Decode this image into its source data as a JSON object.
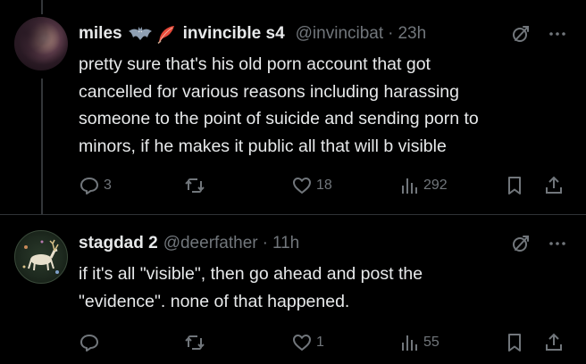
{
  "tweets": [
    {
      "name": "miles",
      "second_name": "invincible s4",
      "handle": "@invincibat",
      "separator": "·",
      "time": "23h",
      "text_lines": [
        "pretty sure that's his old porn account that got",
        "cancelled for various reasons including harassing",
        "someone to the point of suicide and sending porn to",
        "minors, if he makes it public all that will b visible"
      ],
      "reply_count": "3",
      "repost_count": "",
      "like_count": "18",
      "view_count": "292",
      "name_emojis": [
        "bat-emoji-icon",
        "feather-emoji-icon"
      ]
    },
    {
      "name": "stagdad 2",
      "handle": "@deerfather",
      "separator": "·",
      "time": "11h",
      "text_lines": [
        "if it's all \"visible\", then go ahead and post the",
        "\"evidence\". none of that happened."
      ],
      "reply_count": "",
      "repost_count": "",
      "like_count": "1",
      "view_count": "55"
    }
  ],
  "colors": {
    "background": "#000000",
    "text_primary": "#e7e9ea",
    "text_secondary": "#71767b",
    "divider": "#2f3336"
  }
}
